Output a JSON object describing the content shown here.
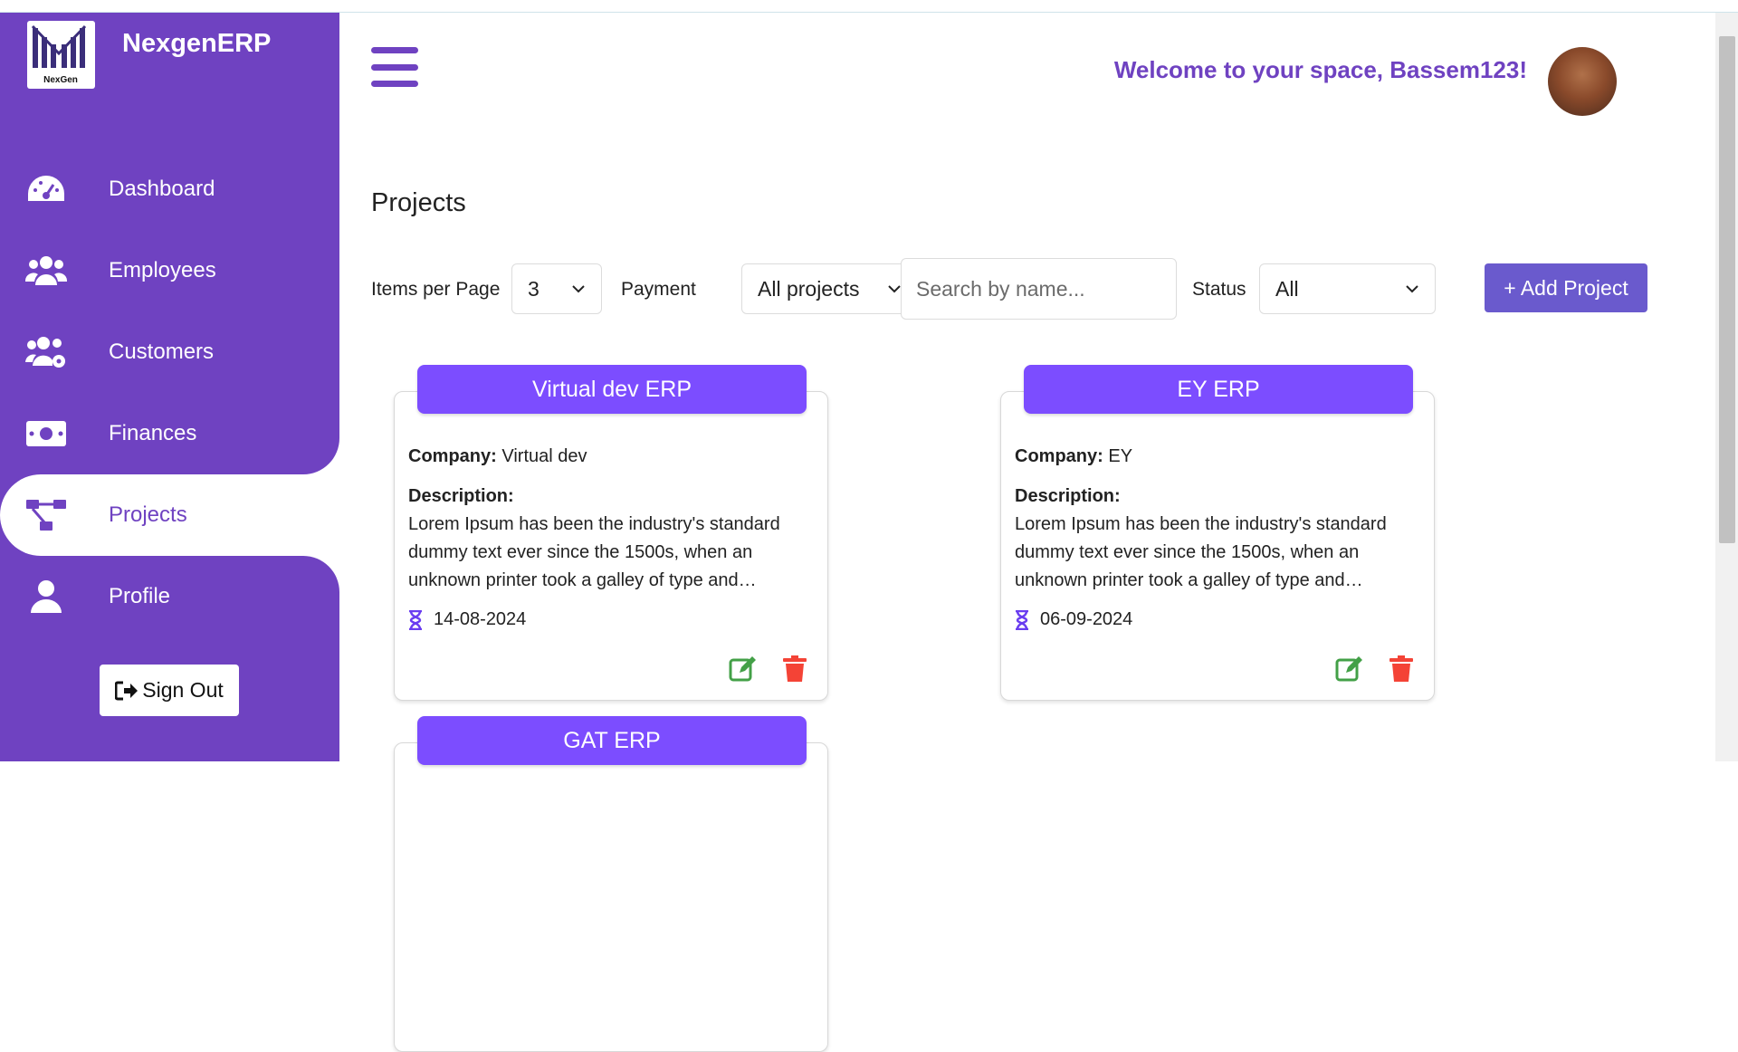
{
  "brand": {
    "name": "NexgenERP",
    "logo_text": "NexGen"
  },
  "nav": {
    "items": [
      {
        "label": "Dashboard",
        "icon": "gauge-icon"
      },
      {
        "label": "Employees",
        "icon": "users-icon"
      },
      {
        "label": "Customers",
        "icon": "users-cog-icon"
      },
      {
        "label": "Finances",
        "icon": "money-bill-icon"
      },
      {
        "label": "Projects",
        "icon": "project-diagram-icon",
        "active": true
      },
      {
        "label": "Profile",
        "icon": "user-icon"
      }
    ],
    "signout_label": "Sign Out"
  },
  "header": {
    "welcome": "Welcome to your space, Bassem123!"
  },
  "page": {
    "title": "Projects"
  },
  "filters": {
    "items_per_page_label": "Items per Page",
    "items_per_page_value": "3",
    "payment_label": "Payment",
    "payment_value": "All projects",
    "search_placeholder": "Search by name...",
    "status_label": "Status",
    "status_value": "All",
    "add_label": "+ Add Project"
  },
  "labels": {
    "company": "Company:",
    "description": "Description:"
  },
  "projects": [
    {
      "name": "Virtual dev ERP",
      "company": "Virtual dev",
      "description": "Lorem Ipsum has been the industry's standard dummy text ever since the 1500s, when an unknown printer took a galley of type and…",
      "date": "14-08-2024"
    },
    {
      "name": "EY ERP",
      "company": "EY",
      "description": "Lorem Ipsum has been the industry's standard dummy text ever since the 1500s, when an unknown printer took a galley of type and…",
      "date": "06-09-2024"
    },
    {
      "name": "GAT ERP"
    }
  ],
  "colors": {
    "primary": "#6f42c1",
    "card_head": "#7c4dff",
    "add_button": "#6a5acd",
    "edit": "#43a047",
    "delete": "#f44336"
  }
}
